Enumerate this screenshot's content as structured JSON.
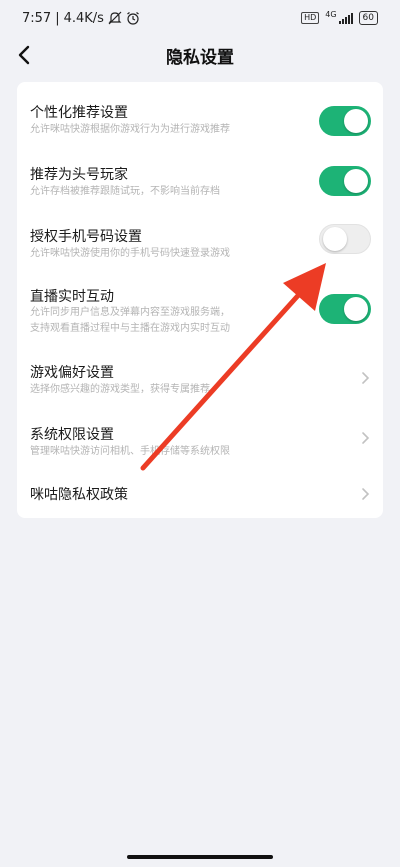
{
  "status_bar": {
    "time": "7:57",
    "speed": "4.4K/s",
    "hd": "HD",
    "network": "4G",
    "battery": "60"
  },
  "nav": {
    "title": "隐私设置"
  },
  "settings": [
    {
      "title": "个性化推荐设置",
      "subtitle": "允许咪咕快游根据你游戏行为为进行游戏推荐",
      "control": "toggle",
      "enabled": true
    },
    {
      "title": "推荐为头号玩家",
      "subtitle": "允许存档被推荐跟随试玩，不影响当前存档",
      "control": "toggle",
      "enabled": true
    },
    {
      "title": "授权手机号码设置",
      "subtitle": "允许咪咕快游使用你的手机号码快速登录游戏",
      "control": "toggle",
      "enabled": false
    },
    {
      "title": "直播实时互动",
      "subtitle": "允许同步用户信息及弹幕内容至游戏服务端，",
      "subtitle2": "支持观看直播过程中与主播在游戏内实时互动",
      "control": "toggle",
      "enabled": true
    },
    {
      "title": "游戏偏好设置",
      "subtitle": "选择你感兴趣的游戏类型，获得专属推荐",
      "control": "chevron"
    },
    {
      "title": "系统权限设置",
      "subtitle": "管理咪咕快游访问相机、手机存储等系统权限",
      "control": "chevron"
    },
    {
      "title": "咪咕隐私权政策",
      "control": "chevron"
    }
  ],
  "colors": {
    "toggle_on": "#1db376",
    "arrow": "#ec3c25",
    "background": "#f1f2f6"
  }
}
